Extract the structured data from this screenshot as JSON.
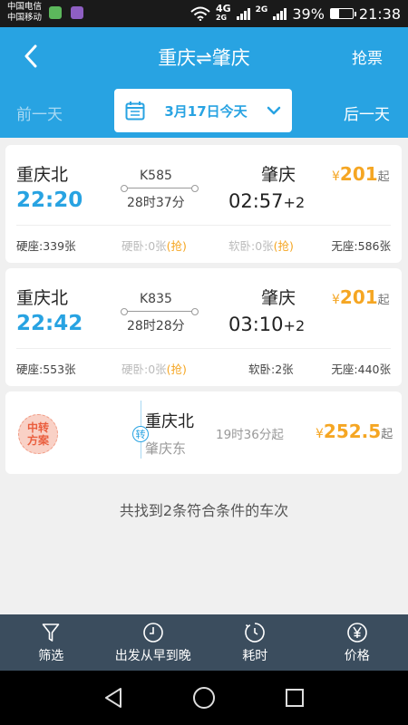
{
  "status_bar": {
    "carrier1": "中国电信",
    "carrier2": "中国移动",
    "net_top": "4G",
    "net_bottom": "2G",
    "net2": "2G",
    "battery": "39%",
    "battery_level": 0.39,
    "time": "21:38"
  },
  "header": {
    "title": "重庆⇌肇庆",
    "grab_ticket": "抢票",
    "prev_day": "前一天",
    "next_day": "后一天",
    "date": "3月17日今天"
  },
  "trains": [
    {
      "from": "重庆北",
      "depart": "22:20",
      "train_no": "K585",
      "duration": "28时37分",
      "to": "肇庆",
      "arrive": "02:57",
      "day_offset": "+2",
      "price_symbol": "¥",
      "price": "201",
      "price_suffix": "起",
      "seats": [
        {
          "label": "硬座:339张",
          "tag": ""
        },
        {
          "label": "硬卧:0张",
          "tag": "(抢)"
        },
        {
          "label": "软卧:0张",
          "tag": "(抢)"
        },
        {
          "label": "无座:586张",
          "tag": ""
        }
      ]
    },
    {
      "from": "重庆北",
      "depart": "22:42",
      "train_no": "K835",
      "duration": "28时28分",
      "to": "肇庆",
      "arrive": "03:10",
      "day_offset": "+2",
      "price_symbol": "¥",
      "price": "201",
      "price_suffix": "起",
      "seats": [
        {
          "label": "硬座:553张",
          "tag": ""
        },
        {
          "label": "硬卧:0张",
          "tag": "(抢)"
        },
        {
          "label": "软卧:2张",
          "tag": ""
        },
        {
          "label": "无座:440张",
          "tag": ""
        }
      ]
    }
  ],
  "transfer": {
    "badge_line1": "中转",
    "badge_line2": "方案",
    "marker": "转",
    "from": "重庆北",
    "to": "肇庆东",
    "duration": "19时36分起",
    "price_symbol": "¥",
    "price": "252.5",
    "price_suffix": "起"
  },
  "summary": "共找到2条符合条件的车次",
  "filter_bar": [
    {
      "label": "筛选",
      "icon": "filter-icon"
    },
    {
      "label": "出发从早到晚",
      "icon": "clock-icon"
    },
    {
      "label": "耗时",
      "icon": "timer-icon"
    },
    {
      "label": "价格",
      "icon": "yen-icon"
    }
  ],
  "colors": {
    "primary": "#28a3e2",
    "price": "#f5a623",
    "filter_bar": "#3b4d5e",
    "transfer_badge": "#ea5e3e"
  }
}
